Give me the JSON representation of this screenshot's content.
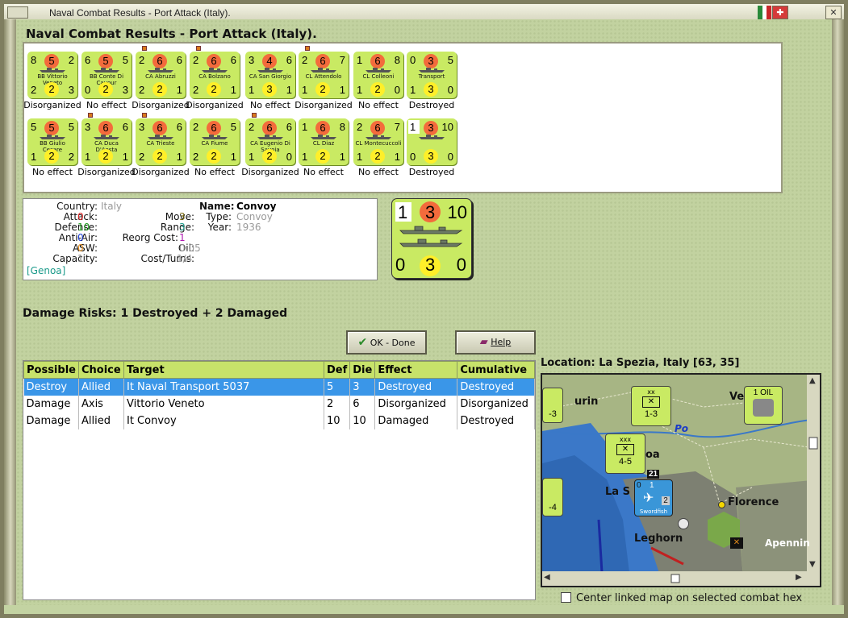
{
  "window": {
    "title": "Naval Combat Results - Port Attack (Italy)."
  },
  "heading": "Naval Combat Results - Port Attack (Italy).",
  "units": [
    {
      "tl": "8",
      "circle": "5",
      "tr": "2",
      "name": "BB Vittorio Veneto",
      "bl": "2",
      "yc": "2",
      "br": "3",
      "result": "Disorganized",
      "badge": false
    },
    {
      "tl": "6",
      "circle": "5",
      "tr": "5",
      "name": "BB Conte Di Cavour",
      "bl": "0",
      "yc": "2",
      "br": "3",
      "result": "No effect",
      "badge": false
    },
    {
      "tl": "2",
      "circle": "6",
      "tr": "6",
      "name": "CA Abruzzi",
      "bl": "2",
      "yc": "2",
      "br": "1",
      "result": "Disorganized",
      "badge": true
    },
    {
      "tl": "2",
      "circle": "6",
      "tr": "6",
      "name": "CA Bolzano",
      "bl": "2",
      "yc": "2",
      "br": "1",
      "result": "Disorganized",
      "badge": true
    },
    {
      "tl": "3",
      "circle": "4",
      "tr": "6",
      "name": "CA San Giorgio",
      "bl": "1",
      "yc": "3",
      "br": "1",
      "result": "No effect",
      "badge": false
    },
    {
      "tl": "2",
      "circle": "6",
      "tr": "7",
      "name": "CL Attendolo",
      "bl": "1",
      "yc": "2",
      "br": "1",
      "result": "Disorganized",
      "badge": true
    },
    {
      "tl": "1",
      "circle": "6",
      "tr": "8",
      "name": "CL Colleoni",
      "bl": "1",
      "yc": "2",
      "br": "0",
      "result": "No effect",
      "badge": false
    },
    {
      "tl": "0",
      "circle": "3",
      "tr": "5",
      "name": "Transport",
      "bl": "1",
      "yc": "3",
      "br": "0",
      "result": "Destroyed",
      "badge": false
    },
    {
      "tl": "5",
      "circle": "5",
      "tr": "5",
      "name": "BB Giulio Cesare",
      "bl": "1",
      "yc": "2",
      "br": "2",
      "result": "No effect",
      "badge": false
    },
    {
      "tl": "3",
      "circle": "6",
      "tr": "6",
      "name": "CA Duca D'Aosta",
      "bl": "1",
      "yc": "2",
      "br": "1",
      "result": "Disorganized",
      "badge": true
    },
    {
      "tl": "3",
      "circle": "6",
      "tr": "6",
      "name": "CA Trieste",
      "bl": "2",
      "yc": "2",
      "br": "1",
      "result": "Disorganized",
      "badge": true
    },
    {
      "tl": "2",
      "circle": "6",
      "tr": "5",
      "name": "CA Fiume",
      "bl": "2",
      "yc": "2",
      "br": "1",
      "result": "No effect",
      "badge": false
    },
    {
      "tl": "2",
      "circle": "6",
      "tr": "6",
      "name": "CA Eugenio Di Savoia",
      "bl": "1",
      "yc": "2",
      "br": "0",
      "result": "Disorganized",
      "badge": true
    },
    {
      "tl": "1",
      "circle": "6",
      "tr": "8",
      "name": "CL Diaz",
      "bl": "1",
      "yc": "2",
      "br": "1",
      "result": "No effect",
      "badge": false
    },
    {
      "tl": "2",
      "circle": "6",
      "tr": "7",
      "name": "CL Montecuccoli",
      "bl": "1",
      "yc": "2",
      "br": "1",
      "result": "No effect",
      "badge": false
    },
    {
      "tl": "1",
      "circle": "3",
      "tr": "10",
      "name": "",
      "bl": "0",
      "yc": "3",
      "br": "0",
      "result": "Destroyed",
      "badge": false
    }
  ],
  "info": {
    "country_label": "Country:",
    "country": "Italy",
    "attack_label": "Attack:",
    "attack": "0",
    "defense_label": "Defense:",
    "defense": "10",
    "antiair_label": "Anti-Air:",
    "antiair": "0",
    "asw_label": "ASW:",
    "asw": "0",
    "capacity_label": "Capacity:",
    "capacity": "1",
    "location": "[Genoa]",
    "move_label": "Move:",
    "move": "3",
    "range_label": "Range:",
    "range": "3",
    "reorg_label": "Reorg Cost:",
    "reorg": "1",
    "oil_label": "Oil:",
    "oil": "0.05",
    "costturns_label": "Cost/Turns:",
    "costturns": "1/4",
    "name_label": "Name:",
    "name": "Convoy",
    "type_label": "Type:",
    "type": "Convoy",
    "year_label": "Year:",
    "year": "1936"
  },
  "big_counter": {
    "tl": "1",
    "circle": "3",
    "tr": "10",
    "bl": "0",
    "yc": "3",
    "br": "0"
  },
  "risk": "Damage Risks: 1 Destroyed + 2 Damaged",
  "buttons": {
    "ok": "OK - Done",
    "help": "Help"
  },
  "table": {
    "headers": [
      "Possible",
      "Choice",
      "Target",
      "Def",
      "Die",
      "Effect",
      "Cumulative"
    ],
    "rows": [
      [
        "Destroy",
        "Allied",
        "It Naval Transport 5037",
        "5",
        "3",
        "Destroyed",
        "Destroyed"
      ],
      [
        "Damage",
        "Axis",
        "Vittorio Veneto",
        "2",
        "6",
        "Disorganized",
        "Disorganized"
      ],
      [
        "Damage",
        "Allied",
        "It Convoy",
        "10",
        "10",
        "Damaged",
        "Destroyed"
      ]
    ]
  },
  "location": "Location:  La Spezia, Italy [63, 35]",
  "map": {
    "labels": {
      "turin": "urin",
      "venice": "Ve",
      "po": "Po",
      "genoa": "oa",
      "laspezia": "La S",
      "florence": "Florence",
      "leghorn": "Leghorn",
      "apennines": "Apennin"
    },
    "oil": "1 OIL",
    "unit1": "1-3",
    "unit2": "4-5",
    "unit3": "-3",
    "unit4": "-4",
    "swordfish": "Swordfish",
    "sw_tl": "0",
    "sw_tc": "1",
    "sw_br": "2",
    "stack": "21",
    "xx": "xx",
    "xxx": "xxx"
  },
  "checkbox": {
    "label": "Center linked map on selected combat hex"
  }
}
